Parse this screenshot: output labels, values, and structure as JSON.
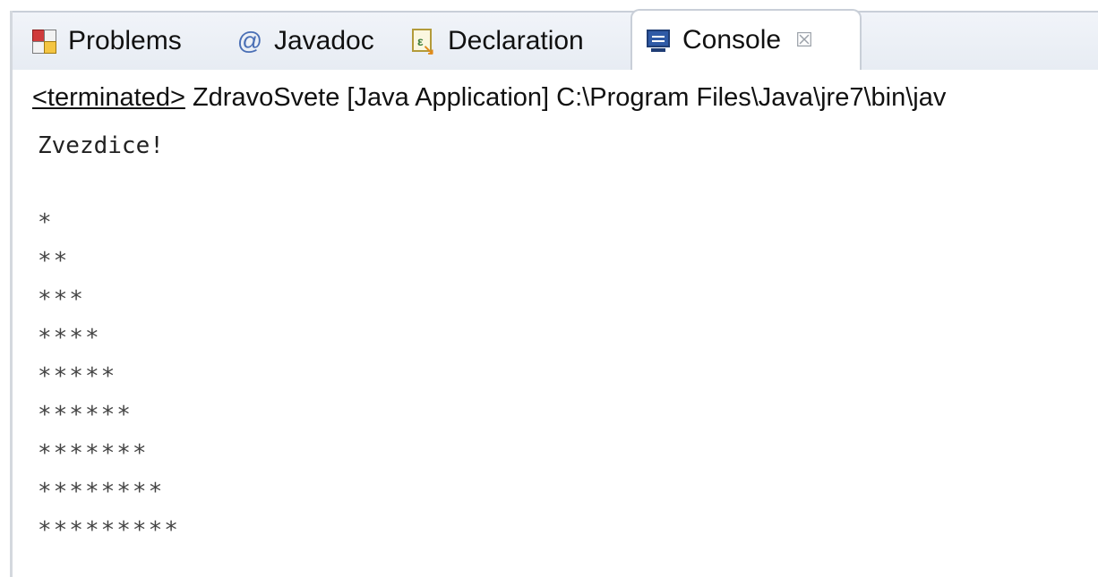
{
  "tabs": [
    {
      "label": "Problems",
      "icon": "problems-icon",
      "active": false
    },
    {
      "label": "Javadoc",
      "icon": "javadoc-icon",
      "icon_glyph": "@",
      "active": false
    },
    {
      "label": "Declaration",
      "icon": "declaration-icon",
      "active": false
    },
    {
      "label": "Console",
      "icon": "console-icon",
      "active": true,
      "close_glyph": "☒"
    }
  ],
  "status": {
    "terminated": "<terminated>",
    "rest": " ZdravoSvete [Java Application] C:\\Program Files\\Java\\jre7\\bin\\jav"
  },
  "output": {
    "heading": "Zvezdice!",
    "blank": "",
    "lines": [
      "*",
      "**",
      "***",
      "****",
      "*****",
      "******",
      "*******",
      "********",
      "*********"
    ]
  },
  "colors": {
    "tab_bar_bg": "#e7ecf3",
    "active_tab_bg": "#ffffff",
    "border": "#c9cfd8"
  }
}
